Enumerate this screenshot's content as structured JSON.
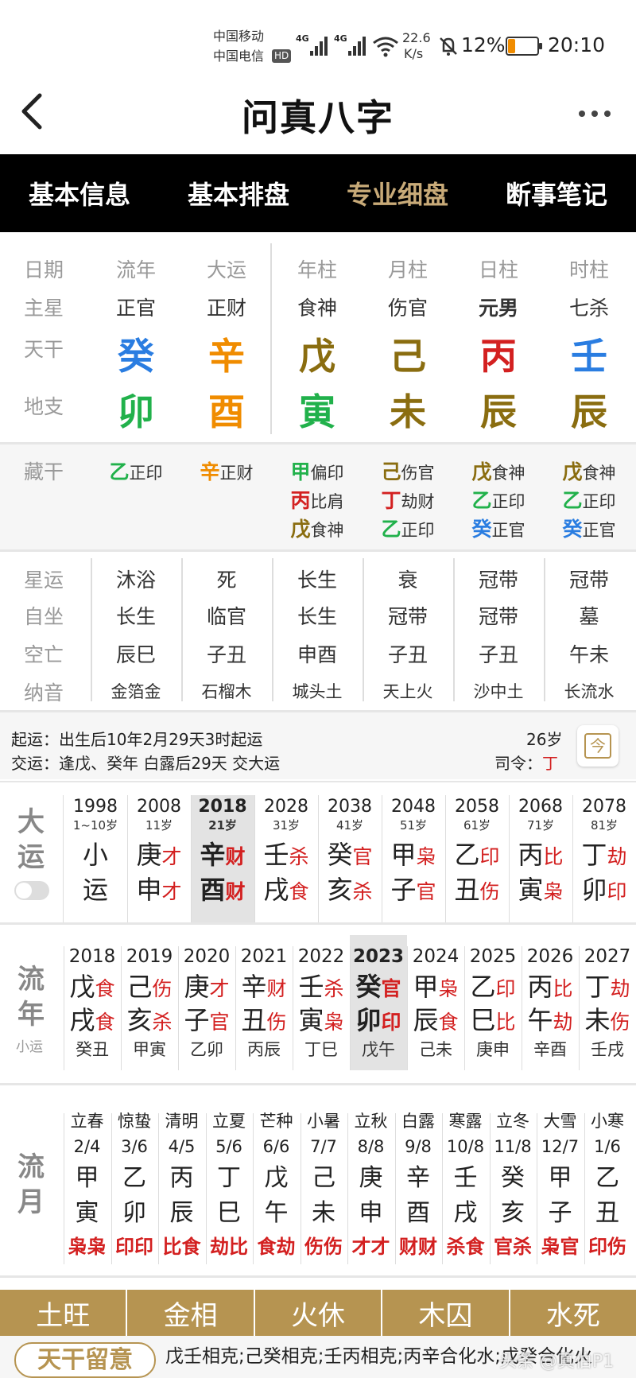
{
  "status": {
    "carrier1": "中国移动",
    "carrier2": "中国电信",
    "hd": "HD",
    "net1": "4G",
    "net2": "4G",
    "speed_value": "22.6",
    "speed_unit": "K/s",
    "battery": "12%",
    "time": "20:10"
  },
  "header": {
    "back": "‹",
    "title": "问真八字",
    "more": "···"
  },
  "tabs": [
    "基本信息",
    "基本排盘",
    "专业细盘",
    "断事笔记"
  ],
  "active_tab": 2,
  "row_labels": {
    "date": "日期",
    "star": "主星",
    "stem": "天干",
    "branch": "地支",
    "hidden": "藏干",
    "xingyun": "星运",
    "zizuo": "自坐",
    "kongwang": "空亡",
    "nayin": "纳音"
  },
  "pillars": [
    {
      "head": "流年",
      "star": "正官",
      "stem": "癸",
      "stem_color": "#2a7de1",
      "branch": "卯",
      "branch_color": "#21b14b",
      "hidden": [
        {
          "c": "乙",
          "color": "#21b14b",
          "s": "正印"
        }
      ],
      "xingyun": "沐浴",
      "zizuo": "长生",
      "kong": "辰巳",
      "nayin": "金箔金"
    },
    {
      "head": "大运",
      "star": "正财",
      "stem": "辛",
      "stem_color": "#f08c00",
      "branch": "酉",
      "branch_color": "#f08c00",
      "hidden": [
        {
          "c": "辛",
          "color": "#f08c00",
          "s": "正财"
        }
      ],
      "xingyun": "死",
      "zizuo": "临官",
      "kong": "子丑",
      "nayin": "石榴木"
    },
    {
      "head": "年柱",
      "star": "食神",
      "stem": "戊",
      "stem_color": "#8a6d10",
      "branch": "寅",
      "branch_color": "#21b14b",
      "hidden": [
        {
          "c": "甲",
          "color": "#21b14b",
          "s": "偏印"
        },
        {
          "c": "丙",
          "color": "#d32020",
          "s": "比肩"
        },
        {
          "c": "戊",
          "color": "#8a6d10",
          "s": "食神"
        }
      ],
      "xingyun": "长生",
      "zizuo": "长生",
      "kong": "申酉",
      "nayin": "城头土"
    },
    {
      "head": "月柱",
      "star": "伤官",
      "stem": "己",
      "stem_color": "#8a6d10",
      "branch": "未",
      "branch_color": "#8a6d10",
      "hidden": [
        {
          "c": "己",
          "color": "#8a6d10",
          "s": "伤官"
        },
        {
          "c": "丁",
          "color": "#d32020",
          "s": "劫财"
        },
        {
          "c": "乙",
          "color": "#21b14b",
          "s": "正印"
        }
      ],
      "xingyun": "衰",
      "zizuo": "冠带",
      "kong": "子丑",
      "nayin": "天上火"
    },
    {
      "head": "日柱",
      "star": "元男",
      "stem": "丙",
      "stem_color": "#d32020",
      "branch": "辰",
      "branch_color": "#8a6d10",
      "hidden": [
        {
          "c": "戊",
          "color": "#8a6d10",
          "s": "食神"
        },
        {
          "c": "乙",
          "color": "#21b14b",
          "s": "正印"
        },
        {
          "c": "癸",
          "color": "#2a7de1",
          "s": "正官"
        }
      ],
      "xingyun": "冠带",
      "zizuo": "冠带",
      "kong": "子丑",
      "nayin": "沙中土"
    },
    {
      "head": "时柱",
      "star": "七杀",
      "stem": "壬",
      "stem_color": "#2a7de1",
      "branch": "辰",
      "branch_color": "#8a6d10",
      "hidden": [
        {
          "c": "戊",
          "color": "#8a6d10",
          "s": "食神"
        },
        {
          "c": "乙",
          "color": "#21b14b",
          "s": "正印"
        },
        {
          "c": "癸",
          "color": "#2a7de1",
          "s": "正官"
        }
      ],
      "xingyun": "冠带",
      "zizuo": "墓",
      "kong": "午未",
      "nayin": "长流水"
    }
  ],
  "qiyun": {
    "l1_label": "起运：",
    "l1": "出生后10年2月29天3时起运",
    "l2_label": "交运：",
    "l2": "逢戊、癸年 白露后29天 交大运",
    "age": "26岁",
    "siling_label": "司令：",
    "siling": "丁",
    "calendar_icon": "今"
  },
  "dayun_label": [
    "大",
    "运"
  ],
  "dayun": [
    {
      "year": "1998",
      "age": "1~10岁",
      "g": "小",
      "z": "运",
      "gs": "",
      "zs": ""
    },
    {
      "year": "2008",
      "age": "11岁",
      "g": "庚",
      "z": "申",
      "gs": "才",
      "zs": "才"
    },
    {
      "year": "2018",
      "age": "21岁",
      "g": "辛",
      "z": "酉",
      "gs": "财",
      "zs": "财",
      "sel": true
    },
    {
      "year": "2028",
      "age": "31岁",
      "g": "壬",
      "z": "戌",
      "gs": "杀",
      "zs": "食"
    },
    {
      "year": "2038",
      "age": "41岁",
      "g": "癸",
      "z": "亥",
      "gs": "官",
      "zs": "杀"
    },
    {
      "year": "2048",
      "age": "51岁",
      "g": "甲",
      "z": "子",
      "gs": "枭",
      "zs": "官"
    },
    {
      "year": "2058",
      "age": "61岁",
      "g": "乙",
      "z": "丑",
      "gs": "印",
      "zs": "伤"
    },
    {
      "year": "2068",
      "age": "71岁",
      "g": "丙",
      "z": "寅",
      "gs": "比",
      "zs": "枭"
    },
    {
      "year": "2078",
      "age": "81岁",
      "g": "丁",
      "z": "卯",
      "gs": "劫",
      "zs": "印"
    }
  ],
  "liunian_label": [
    "流",
    "年"
  ],
  "xiaoyun_label": "小运",
  "liunian": [
    {
      "year": "2018",
      "g": "戊",
      "z": "戌",
      "gs": "食",
      "zs": "食",
      "xy": "癸丑"
    },
    {
      "year": "2019",
      "g": "己",
      "z": "亥",
      "gs": "伤",
      "zs": "杀",
      "xy": "甲寅"
    },
    {
      "year": "2020",
      "g": "庚",
      "z": "子",
      "gs": "才",
      "zs": "官",
      "xy": "乙卯"
    },
    {
      "year": "2021",
      "g": "辛",
      "z": "丑",
      "gs": "财",
      "zs": "伤",
      "xy": "丙辰"
    },
    {
      "year": "2022",
      "g": "壬",
      "z": "寅",
      "gs": "杀",
      "zs": "枭",
      "xy": "丁巳"
    },
    {
      "year": "2023",
      "g": "癸",
      "z": "卯",
      "gs": "官",
      "zs": "印",
      "xy": "戊午",
      "sel": true
    },
    {
      "year": "2024",
      "g": "甲",
      "z": "辰",
      "gs": "枭",
      "zs": "食",
      "xy": "己未"
    },
    {
      "year": "2025",
      "g": "乙",
      "z": "巳",
      "gs": "印",
      "zs": "比",
      "xy": "庚申"
    },
    {
      "year": "2026",
      "g": "丙",
      "z": "午",
      "gs": "比",
      "zs": "劫",
      "xy": "辛酉"
    },
    {
      "year": "2027",
      "g": "丁",
      "z": "未",
      "gs": "劫",
      "zs": "伤",
      "xy": "壬戌"
    }
  ],
  "liuyue_label": [
    "流",
    "月"
  ],
  "liuyue": [
    {
      "term": "立春",
      "date": "2/4",
      "g": "甲",
      "z": "寅",
      "ss": "枭枭"
    },
    {
      "term": "惊蛰",
      "date": "3/6",
      "g": "乙",
      "z": "卯",
      "ss": "印印"
    },
    {
      "term": "清明",
      "date": "4/5",
      "g": "丙",
      "z": "辰",
      "ss": "比食"
    },
    {
      "term": "立夏",
      "date": "5/6",
      "g": "丁",
      "z": "巳",
      "ss": "劫比"
    },
    {
      "term": "芒种",
      "date": "6/6",
      "g": "戊",
      "z": "午",
      "ss": "食劫"
    },
    {
      "term": "小暑",
      "date": "7/7",
      "g": "己",
      "z": "未",
      "ss": "伤伤"
    },
    {
      "term": "立秋",
      "date": "8/8",
      "g": "庚",
      "z": "申",
      "ss": "才才"
    },
    {
      "term": "白露",
      "date": "9/8",
      "g": "辛",
      "z": "酉",
      "ss": "财财"
    },
    {
      "term": "寒露",
      "date": "10/8",
      "g": "壬",
      "z": "戌",
      "ss": "杀食"
    },
    {
      "term": "立冬",
      "date": "11/8",
      "g": "癸",
      "z": "亥",
      "ss": "官杀"
    },
    {
      "term": "大雪",
      "date": "12/7",
      "g": "甲",
      "z": "子",
      "ss": "枭官"
    },
    {
      "term": "小寒",
      "date": "1/6",
      "g": "乙",
      "z": "丑",
      "ss": "印伤"
    }
  ],
  "wuxing": [
    "土旺",
    "金相",
    "火休",
    "木囚",
    "水死"
  ],
  "note": {
    "label": "天干留意",
    "text": "戊壬相克;己癸相克;壬丙相克;丙辛合化水;戊癸合化火",
    "watermark": "头条 @真伯P1"
  }
}
